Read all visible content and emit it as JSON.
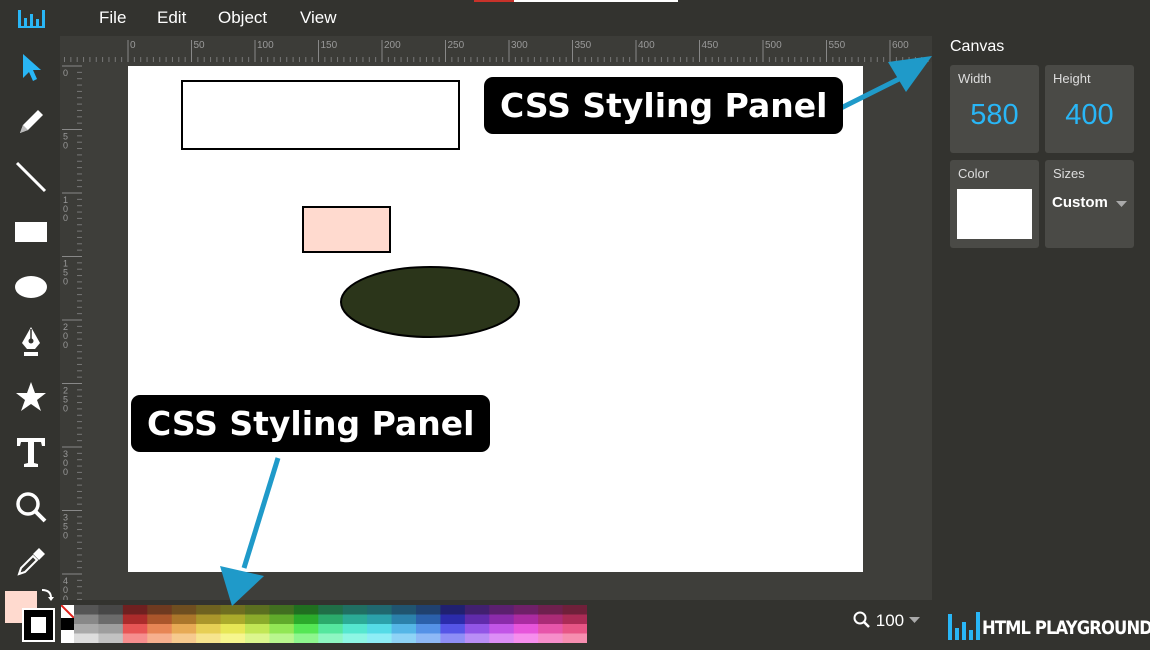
{
  "menu": {
    "file": "File",
    "edit": "Edit",
    "object": "Object",
    "view": "View"
  },
  "ruler_top_labels": [
    "0",
    "50",
    "100",
    "150",
    "200",
    "250",
    "300",
    "350",
    "400",
    "450",
    "500",
    "550",
    "600"
  ],
  "ruler_left_labels": [
    "0",
    "50",
    "100",
    "150",
    "200",
    "250",
    "300",
    "350",
    "400"
  ],
  "panel": {
    "title": "Canvas",
    "width_label": "Width",
    "width_value": "580",
    "height_label": "Height",
    "height_value": "400",
    "color_label": "Color",
    "color_value": "#ffffff",
    "sizes_label": "Sizes",
    "sizes_value": "Custom"
  },
  "zoom": {
    "value": "100"
  },
  "brand": {
    "name": "HTML PLAYGROUND"
  },
  "callouts": {
    "top": "CSS Styling Panel",
    "bottom": "CSS Styling Panel"
  },
  "colors": {
    "accent": "#29b6f6",
    "arrow": "#1f9ac9",
    "fill_primary": "#ffdacf",
    "fill_dark": "#2b351a"
  },
  "shapes": [
    {
      "type": "rect",
      "fill": "#ffffff",
      "stroke": "#000000"
    },
    {
      "type": "rect",
      "fill": "#ffdacf",
      "stroke": "#000000"
    },
    {
      "type": "ellipse",
      "fill": "#2b351a",
      "stroke": "#000000"
    }
  ],
  "icons": {
    "logo": "logo-icon",
    "select": "select-arrow-icon",
    "pencil": "pencil-icon",
    "line": "line-icon",
    "rect": "rectangle-icon",
    "ellipse": "ellipse-icon",
    "pen": "pen-tool-icon",
    "star": "star-icon",
    "text": "text-icon",
    "zoom": "magnifier-icon",
    "eyedropper": "eyedropper-icon"
  }
}
